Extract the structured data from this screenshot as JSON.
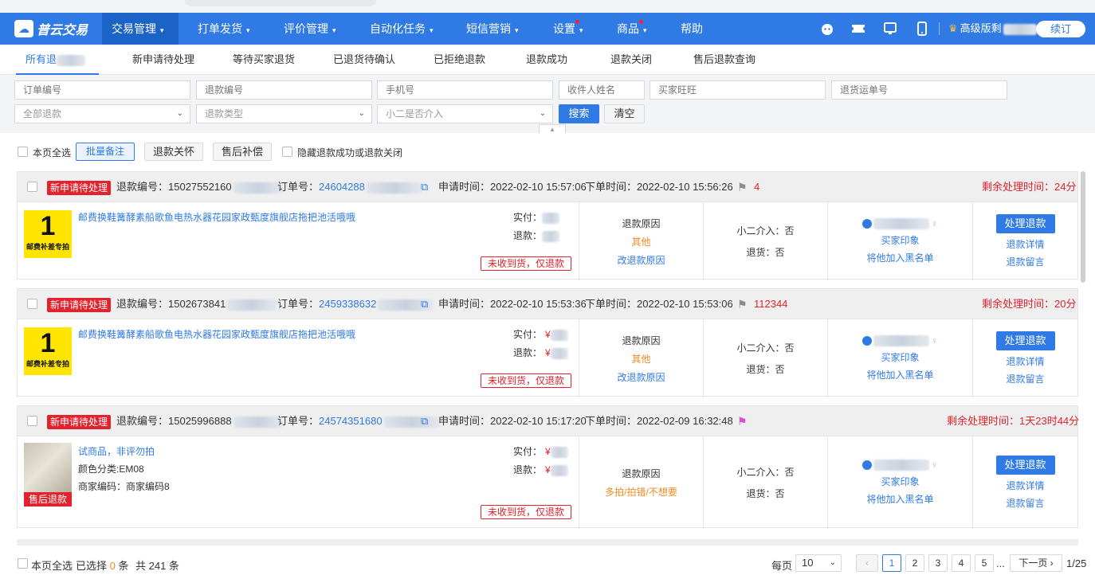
{
  "app": {
    "logo_text": "普云交易"
  },
  "topnav": {
    "items": [
      "交易管理",
      "打单发货",
      "评价管理",
      "自动化任务",
      "短信营销",
      "设置",
      "商品",
      "帮助"
    ],
    "vip_label": "高级版剩",
    "renew_label": "续订"
  },
  "subtabs": [
    "所有退",
    "新申请待处理",
    "等待买家退货",
    "已退货待确认",
    "已拒绝退款",
    "退款成功",
    "退款关闭",
    "售后退款查询"
  ],
  "filters": {
    "order_no": "订单编号",
    "refund_no": "退款编号",
    "phone": "手机号",
    "receiver": "收件人姓名",
    "buyer": "买家旺旺",
    "return_no": "退货运单号",
    "refund_status": "全部退款",
    "refund_type": "退款类型",
    "intervene": "小二是否介入",
    "search_label": "搜索",
    "clear_label": "清空"
  },
  "actions": {
    "select_page": "本页全选",
    "batch_note": "批量备注",
    "refund_care": "退款关怀",
    "after_sale_comp": "售后补偿",
    "hide_label": "隐藏退款成功或退款关闭"
  },
  "labels": {
    "refund_no": "退款编号：",
    "order_no": "订单号：",
    "apply_time": "申请时间：",
    "order_time": "下单时间：",
    "paid": "实付：",
    "refund": "退款：",
    "reason_title": "退款原因",
    "change_reason": "改退款原因",
    "intervene": "小二介入：否",
    "returned": "退货：否",
    "buyer_impression": "买家印象",
    "blacklist": "将他加入黑名单",
    "process": "处理退款",
    "detail": "退款详情",
    "message": "退款留言"
  },
  "orders": [
    {
      "status": "新申请待处理",
      "refund_no": "15027552160",
      "order_no": "24604288",
      "apply_time": "2022-02-10 15:57:06",
      "order_time": "2022-02-10 15:56:26",
      "flag_text": "4",
      "remaining": "剩余处理时间：24分",
      "product_title": "邮费换鞋篝酵素船歌鱼电热水器花园家政甄度旗舰店拖把池活哦哦",
      "thumb_big": "1",
      "thumb_caption": "邮费补差专拍",
      "reason": "其他",
      "refund_tag": "未收到货，仅退款"
    },
    {
      "status": "新申请待处理",
      "refund_no": "1502673841",
      "order_no": "2459338632",
      "apply_time": "2022-02-10 15:53:36",
      "order_time": "2022-02-10 15:53:06",
      "flag_text": "112344",
      "remaining": "剩余处理时间：20分",
      "product_title": "邮费换鞋篝酵素船歌鱼电热水器花园家政甄度旗舰店拖把池活哦哦",
      "thumb_big": "1",
      "thumb_caption": "邮费补差专拍",
      "price_symbol": "¥",
      "reason": "其他",
      "refund_tag": "未收到货，仅退款"
    },
    {
      "status": "新申请待处理",
      "refund_no": "15025996888",
      "order_no": "24574351680",
      "apply_time": "2022-02-10 15:17:20",
      "order_time": "2022-02-09 16:32:48",
      "flag_text": "",
      "remaining": "剩余处理时间：1天23时44分",
      "product_title": "试商品，非评勿拍",
      "sku": "颜色分类:EM08",
      "merchant_code": "商家编码：商家编码8",
      "thumb_tag": "售后退款",
      "price_symbol": "¥",
      "reason": "多拍/拍错/不想要",
      "refund_tag": "未收到货，仅退款"
    }
  ],
  "footer": {
    "select_page": "本页全选",
    "selected_prefix": "已选择",
    "selected_count": "0",
    "selected_unit": "条",
    "total": "共 241 条",
    "per_page_label": "每页",
    "per_page": "10",
    "pages": [
      "1",
      "2",
      "3",
      "4",
      "5"
    ],
    "ellipsis": "...",
    "next": "下一页",
    "page_info": "1/25"
  }
}
